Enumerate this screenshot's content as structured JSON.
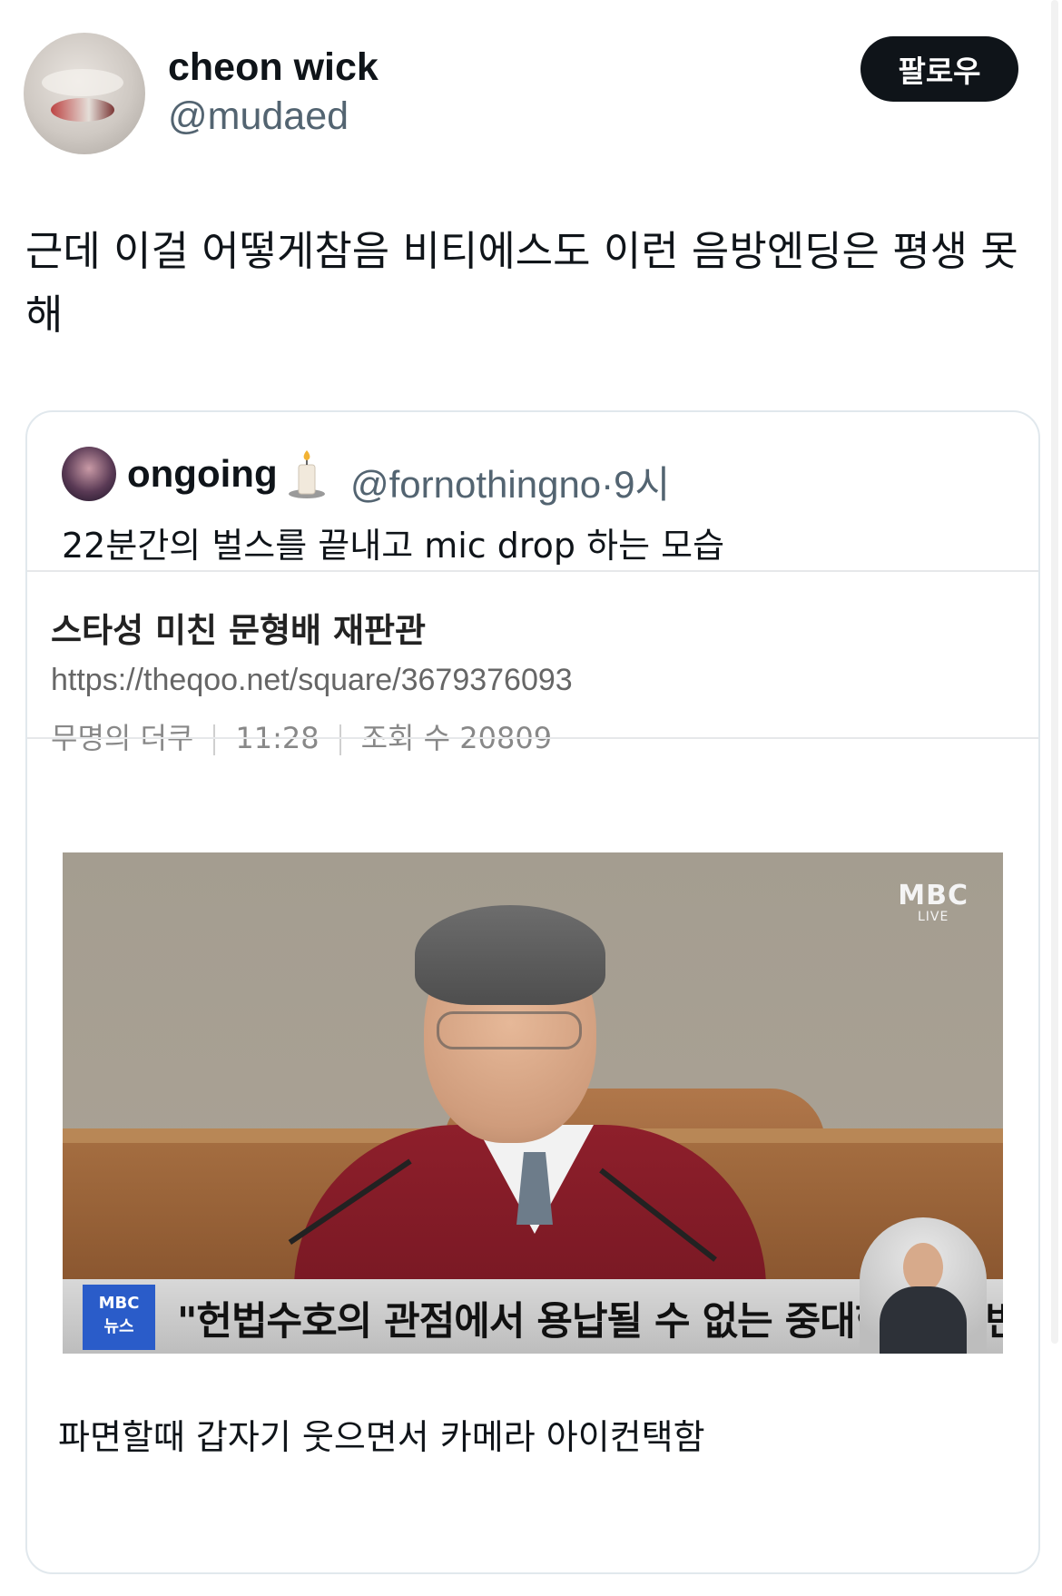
{
  "author": {
    "display_name": "cheon wick",
    "handle": "@mudaed",
    "avatar_icon": "profile-photo"
  },
  "follow_button": {
    "label": "팔로우"
  },
  "tweet": {
    "text": "근데 이걸 어떻게참음 비티에스도 이런 음방엔딩은 평생 못해"
  },
  "quoted_tweet": {
    "display_name": "ongoing",
    "emoji_icon": "candle-icon",
    "handle": "@fornothingno",
    "separator": "·",
    "time": "9시",
    "text": "22분간의 벌스를 끝내고 mic drop 하는 모습",
    "post": {
      "title": "스타성 미친 문형배 재판관",
      "url": "https://theqoo.net/square/3679376093",
      "author": "무명의 더쿠",
      "time": "11:28",
      "views": "조회 수 20809"
    },
    "video_frame": {
      "watermark_main": "MBC",
      "watermark_sub": "LIVE",
      "news_logo_top": "MBC",
      "news_logo_bottom": "뉴스",
      "caption": "\"헌법수호의 관점에서 용납될 수 없는 중대한 법 위반\""
    },
    "bottom_text": "파면할때 갑자기 웃으면서 카메라 아이컨택함"
  },
  "colors": {
    "text_primary": "#0f1419",
    "text_secondary": "#536471",
    "button_bg": "#0f1419",
    "border": "#e1e8ed",
    "news_blue": "#2a5cc9"
  }
}
